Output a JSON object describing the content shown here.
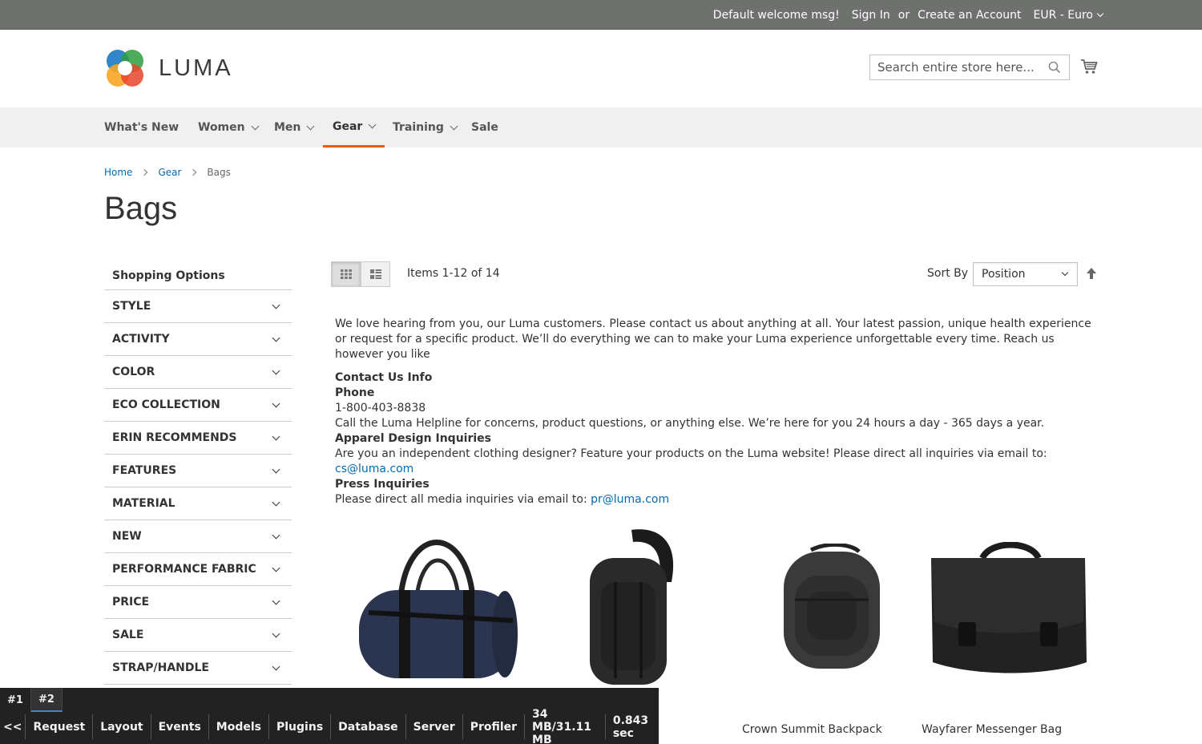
{
  "topbar": {
    "welcome": "Default welcome msg!",
    "sign_in": "Sign In",
    "or": "or",
    "create_account": "Create an Account",
    "currency": "EUR - Euro"
  },
  "header": {
    "logo_text": "LUMA",
    "search_placeholder": "Search entire store here..."
  },
  "nav": {
    "items": [
      {
        "label": "What's New"
      },
      {
        "label": "Women"
      },
      {
        "label": "Men"
      },
      {
        "label": "Gear"
      },
      {
        "label": "Training"
      },
      {
        "label": "Sale"
      }
    ]
  },
  "breadcrumbs": [
    "Home",
    "Gear",
    "Bags"
  ],
  "page_title": "Bags",
  "sidebar": {
    "subtitle": "Shopping Options",
    "filters": [
      "STYLE",
      "ACTIVITY",
      "COLOR",
      "ECO COLLECTION",
      "ERIN RECOMMENDS",
      "FEATURES",
      "MATERIAL",
      "NEW",
      "PERFORMANCE FABRIC",
      "PRICE",
      "SALE",
      "STRAP/HANDLE"
    ]
  },
  "toolbar": {
    "amount": "Items 1-12 of 14",
    "sort_label": "Sort By",
    "sort_value": "Position"
  },
  "cms": {
    "intro": "We love hearing from you, our Luma customers. Please contact us about anything at all. Your latest passion, unique health experience or request for a specific product. We’ll do everything we can to make your Luma experience unforgettable every time. Reach us however you like",
    "contact_title": "Contact Us Info",
    "phone_title": "Phone",
    "phone": "1-800-403-8838",
    "phone_desc": "Call the Luma Helpline for concerns, product questions, or anything else. We’re here for you 24 hours a day - 365 days a year.",
    "apparel_title": "Apparel Design Inquiries",
    "apparel_desc": "Are you an independent clothing designer? Feature your products on the Luma website! Please direct all inquiries via email to: ",
    "apparel_email": "cs@luma.com",
    "press_title": "Press Inquiries",
    "press_desc": "Please direct all media inquiries via email to: ",
    "press_email": "pr@luma.com"
  },
  "products": [
    {
      "name": ""
    },
    {
      "name": ""
    },
    {
      "name": "Crown Summit Backpack"
    },
    {
      "name": "Wayfarer Messenger Bag"
    }
  ],
  "debug": {
    "tabs": [
      "#1",
      "#2"
    ],
    "toggle": "<<",
    "menu": [
      "Request",
      "Layout",
      "Events",
      "Models",
      "Plugins",
      "Database",
      "Server",
      "Profiler",
      "34 MB/31.11 MB",
      "0.843 sec"
    ]
  },
  "colors": {
    "topbar_bg": "#6e716e",
    "nav_bg": "#f0f0f0",
    "nav_active_underline": "#ff5501",
    "link": "#006bb4",
    "debug_bg": "#222222"
  }
}
